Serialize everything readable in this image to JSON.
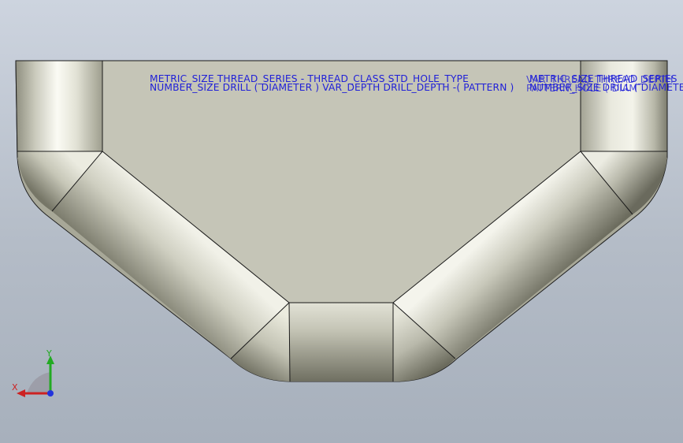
{
  "annotations": {
    "line1": "METRIC_SIZE THREAD_SERIES - THREAD_CLASS STD_HOLE_TYPE",
    "line2": "NUMBER_SIZE DRILL ( DIAMETER ) VAR_DEPTH DRILL_DEPTH -( PATTERN )",
    "overlap1": "METRIC_SIZE THREAD_SERIES",
    "overlap2": "NUMBER_SIZE DRILL ( DIAMETER )",
    "overlap3": "VAR_THREAD THREAD_DEPTH",
    "overlap4": "PATTERN_HOLE ( DIAM"
  },
  "triad": {
    "x_label": "X",
    "y_label": "Y"
  },
  "colors": {
    "face": "#c5c5b7",
    "annotation": "#1f1fd8",
    "x_axis": "#cc2222",
    "y_axis": "#22aa22",
    "z_axis": "#2233dd"
  }
}
